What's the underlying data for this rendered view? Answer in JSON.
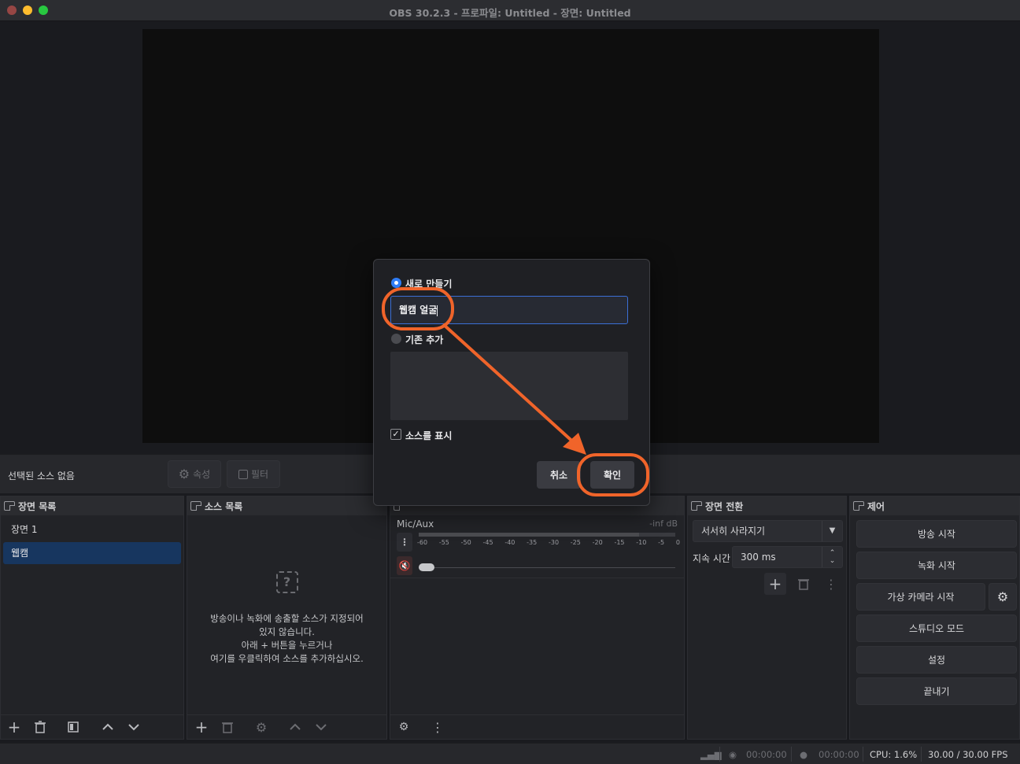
{
  "window": {
    "title": "OBS 30.2.3 - 프로파일: Untitled - 장면: Untitled"
  },
  "source_toolbar": {
    "no_source": "선택된 소스 없음",
    "properties": "속성",
    "filters": "필터"
  },
  "scenes": {
    "title": "장면 목록",
    "items": [
      {
        "label": "장면 1"
      },
      {
        "label": "웹캠"
      }
    ]
  },
  "sources": {
    "title": "소스 목록",
    "empty_line1": "방송이나 녹화에 송출할 소스가 지정되어",
    "empty_line2": "있지 않습니다.",
    "empty_line3": "아래 + 버튼을 누르거나",
    "empty_line4": "여기를 우클릭하여 소스를 추가하십시오."
  },
  "mixer": {
    "channel": "Mic/Aux",
    "level": "-inf dB",
    "ticks": [
      "-60",
      "-55",
      "-50",
      "-45",
      "-40",
      "-35",
      "-30",
      "-25",
      "-20",
      "-15",
      "-10",
      "-5",
      "0"
    ]
  },
  "transitions": {
    "title": "장면 전환",
    "type": "서서히 사라지기",
    "duration_label": "지속 시간",
    "duration": "300 ms"
  },
  "controls": {
    "title": "제어",
    "start_stream": "방송 시작",
    "start_record": "녹화 시작",
    "start_vcam": "가상 카메라 시작",
    "studio_mode": "스튜디오 모드",
    "settings": "설정",
    "exit": "끝내기"
  },
  "status": {
    "stream_time": "00:00:00",
    "record_time": "00:00:00",
    "cpu": "CPU: 1.6%",
    "fps": "30.00 / 30.00 FPS"
  },
  "dialog": {
    "create_new": "새로 만들기",
    "name_value": "웹캠 얼굴",
    "add_existing": "기존 추가",
    "make_visible": "소스를 표시",
    "cancel": "취소",
    "ok": "확인"
  },
  "colors": {
    "accent": "#2f7df6",
    "annotation": "#f0642a",
    "selected_scene": "#17365f"
  }
}
